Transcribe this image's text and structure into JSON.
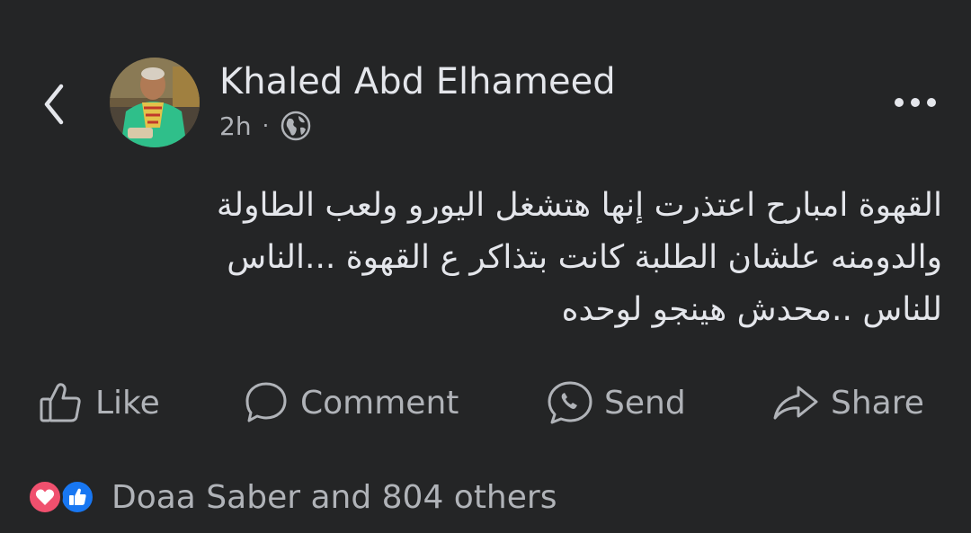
{
  "header": {
    "author_name": "Khaled Abd Elhameed",
    "timestamp": "2h",
    "separator": "·",
    "audience_icon": "globe-icon",
    "back_icon": "chevron-left-icon",
    "more_icon": "more-horizontal-icon"
  },
  "post": {
    "lines": [
      "القهوة امبارح اعتذرت إنها هتشغل اليورو ولعب الطاولة",
      "والدومنه علشان الطلبة كانت بتذاكر ع القهوة ...الناس",
      "للناس ..محدش هينجو لوحده"
    ]
  },
  "actions": {
    "like": {
      "label": "Like",
      "icon": "thumbs-up-icon"
    },
    "comment": {
      "label": "Comment",
      "icon": "comment-bubble-icon"
    },
    "send": {
      "label": "Send",
      "icon": "messenger-send-icon"
    },
    "share": {
      "label": "Share",
      "icon": "share-arrow-icon"
    }
  },
  "reactions": {
    "summary": "Doaa Saber and 804 others",
    "icons": [
      "heart-reaction-icon",
      "like-reaction-icon"
    ]
  },
  "colors": {
    "background": "#242526",
    "primary_text": "#e4e6eb",
    "secondary_text": "#b0b3b8",
    "love": "#f0506e",
    "like": "#1877f2"
  }
}
